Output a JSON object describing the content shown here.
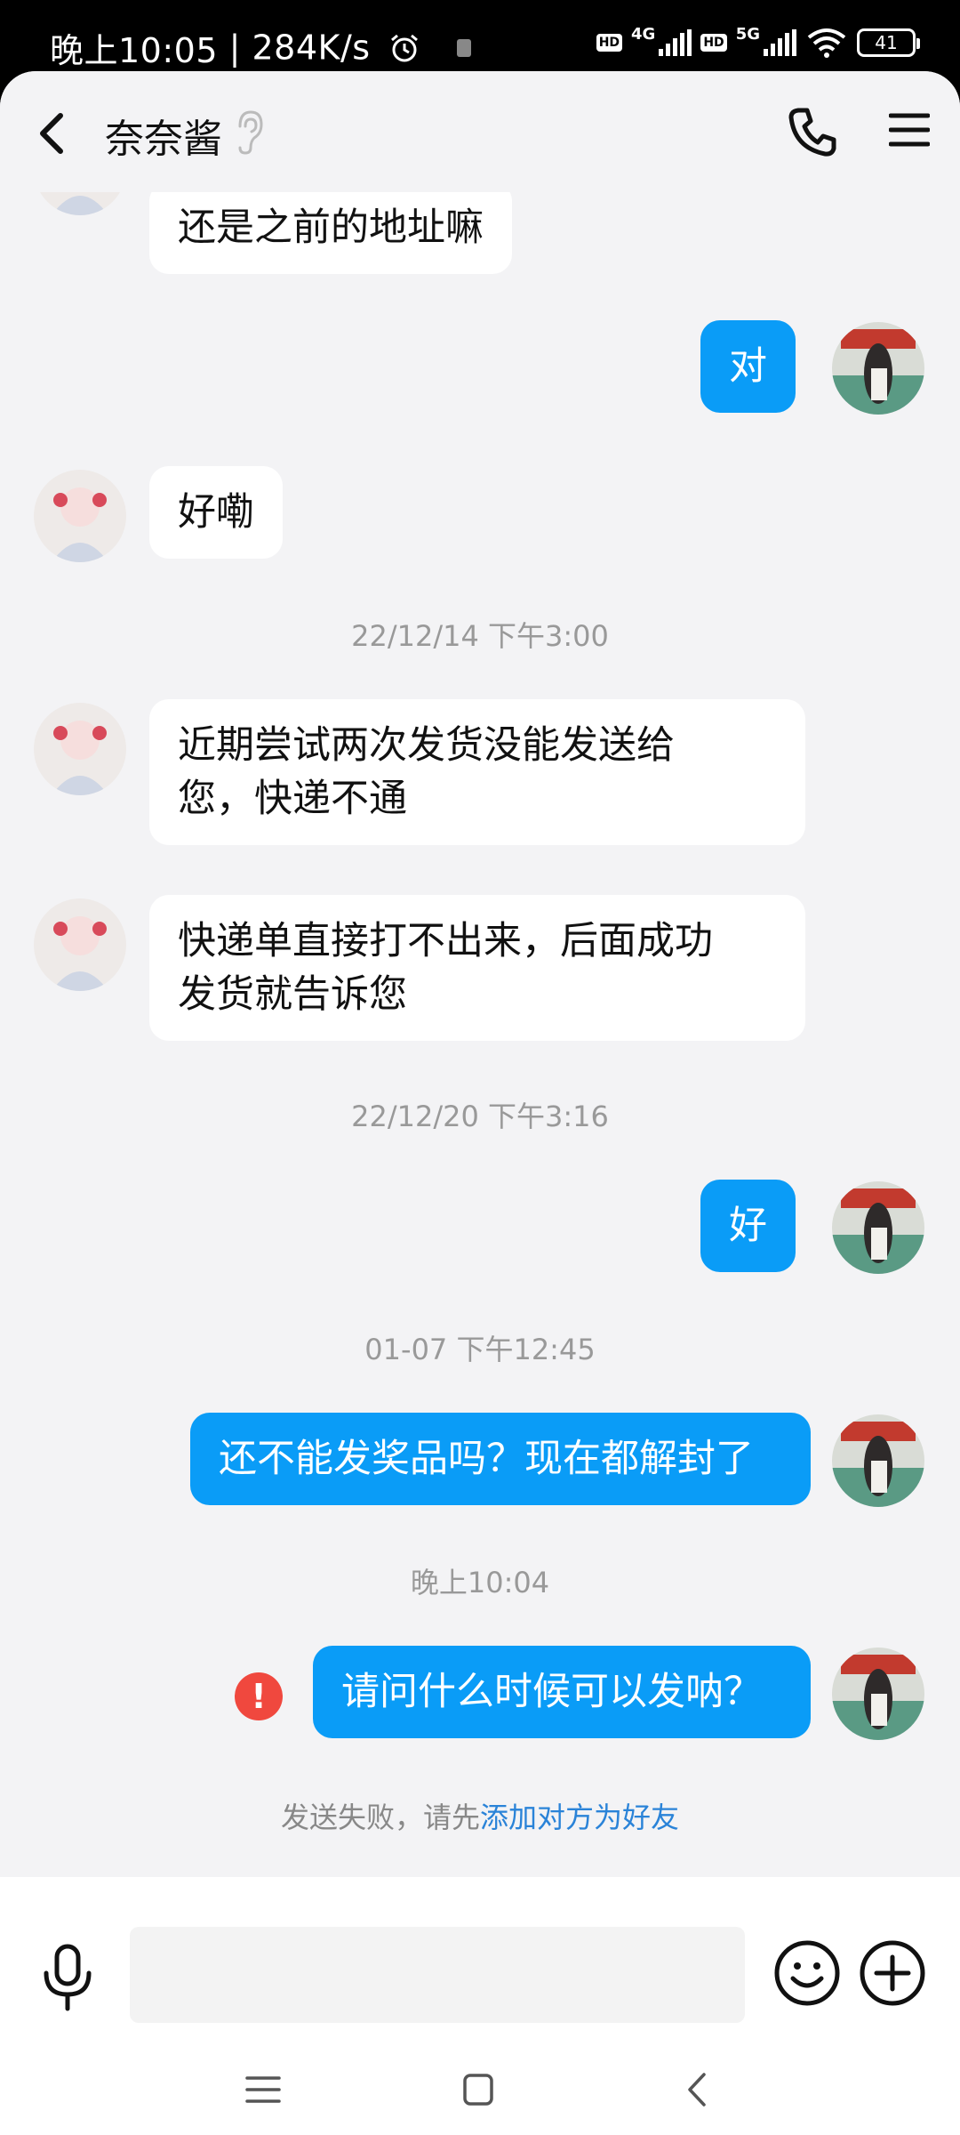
{
  "status_bar": {
    "time": "晚上10:05",
    "speed": "284K/s",
    "network1": "4G",
    "network2": "5G",
    "hd": "HD",
    "battery": "41"
  },
  "header": {
    "title": "奈奈酱",
    "icons": [
      "back-icon",
      "ear-icon",
      "phone-icon",
      "menu-icon"
    ]
  },
  "messages": [
    {
      "side": "in",
      "text": "还是之前的地址嘛"
    },
    {
      "side": "out",
      "text": "对"
    },
    {
      "side": "in",
      "text": "好嘞"
    },
    {
      "type": "time",
      "text": "22/12/14 下午3:00"
    },
    {
      "side": "in",
      "lines": [
        "近期尝试两次发货没能发送给",
        "您，快递不通"
      ]
    },
    {
      "side": "in",
      "lines": [
        "快递单直接打不出来，后面成功",
        "发货就告诉您"
      ]
    },
    {
      "type": "time",
      "text": "22/12/20 下午3:16"
    },
    {
      "side": "out",
      "text": "好"
    },
    {
      "type": "time",
      "text": "01-07 下午12:45"
    },
    {
      "side": "out",
      "text": "还不能发奖品吗？现在都解封了"
    },
    {
      "type": "time",
      "text": "晚上10:04"
    },
    {
      "side": "out",
      "text": "请问什么时候可以发呐？",
      "failed": true,
      "fail_mark": "!"
    }
  ],
  "failure_notice": {
    "prefix": "发送失败，请先",
    "link": "添加对方为好友"
  },
  "input_bar": {
    "icons": [
      "microphone-icon",
      "emoji-icon",
      "plus-icon"
    ]
  },
  "nav_bar": {
    "icons": [
      "nav-menu-icon",
      "nav-home-icon",
      "nav-back-icon"
    ]
  },
  "colors": {
    "outgoing_bubble": "#0a9cf7",
    "incoming_bubble": "#ffffff",
    "chat_background": "#f3f3f5",
    "fail_badge": "#f0483e",
    "link": "#2a83d8"
  }
}
